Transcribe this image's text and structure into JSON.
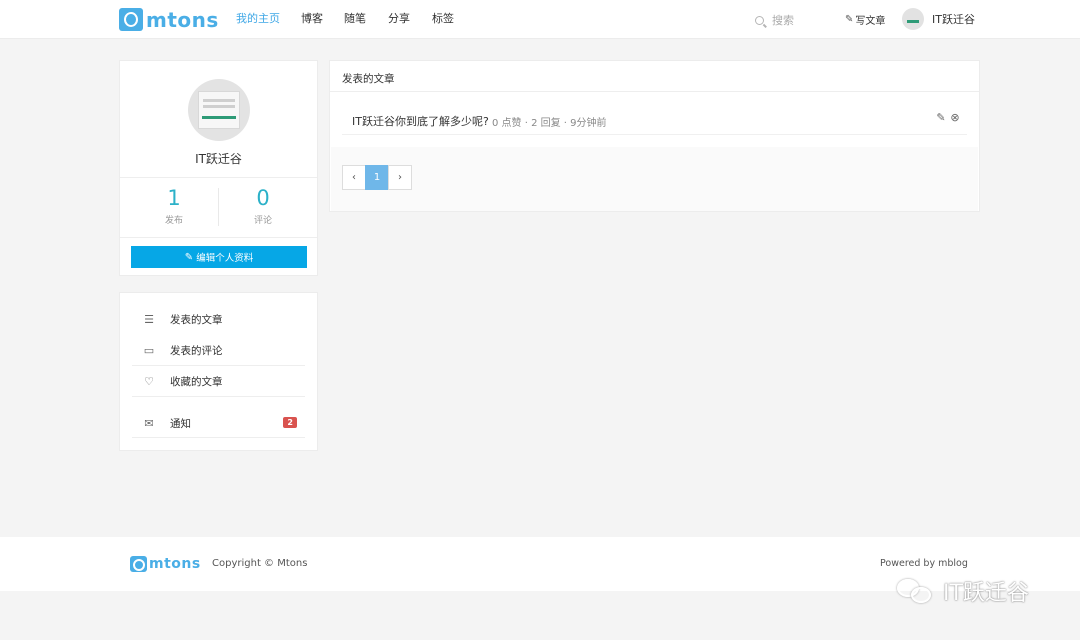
{
  "navbar": {
    "logo_text": "mtons",
    "links": [
      "我的主页",
      "博客",
      "随笔",
      "分享",
      "标签"
    ],
    "search_placeholder": "搜索",
    "write_label": "写文章",
    "user_name": "IT跃迁谷"
  },
  "profile": {
    "name": "IT跃迁谷",
    "stats": [
      {
        "value": "1",
        "label": "发布"
      },
      {
        "value": "0",
        "label": "评论"
      }
    ],
    "edit_button": "编辑个人资料"
  },
  "menu": {
    "items": [
      {
        "label": "发表的文章",
        "icon": "list-icon"
      },
      {
        "label": "发表的评论",
        "icon": "comment-icon"
      },
      {
        "label": "收藏的文章",
        "icon": "heart-icon"
      },
      {
        "label": "通知",
        "icon": "mail-icon",
        "badge": "2"
      }
    ]
  },
  "articles": {
    "title": "发表的文章",
    "items": [
      {
        "title": "IT跃迁谷你到底了解多少呢?",
        "meta": "0 点赞 · 2 回复 · 9分钟前"
      }
    ],
    "pagination": {
      "prev": "‹",
      "current": "1",
      "next": "›"
    }
  },
  "footer": {
    "logo_text": "mtons",
    "copyright": "Copyright © Mtons",
    "powered": "Powered by mblog"
  },
  "watermark": {
    "text": "IT跃迁谷"
  }
}
